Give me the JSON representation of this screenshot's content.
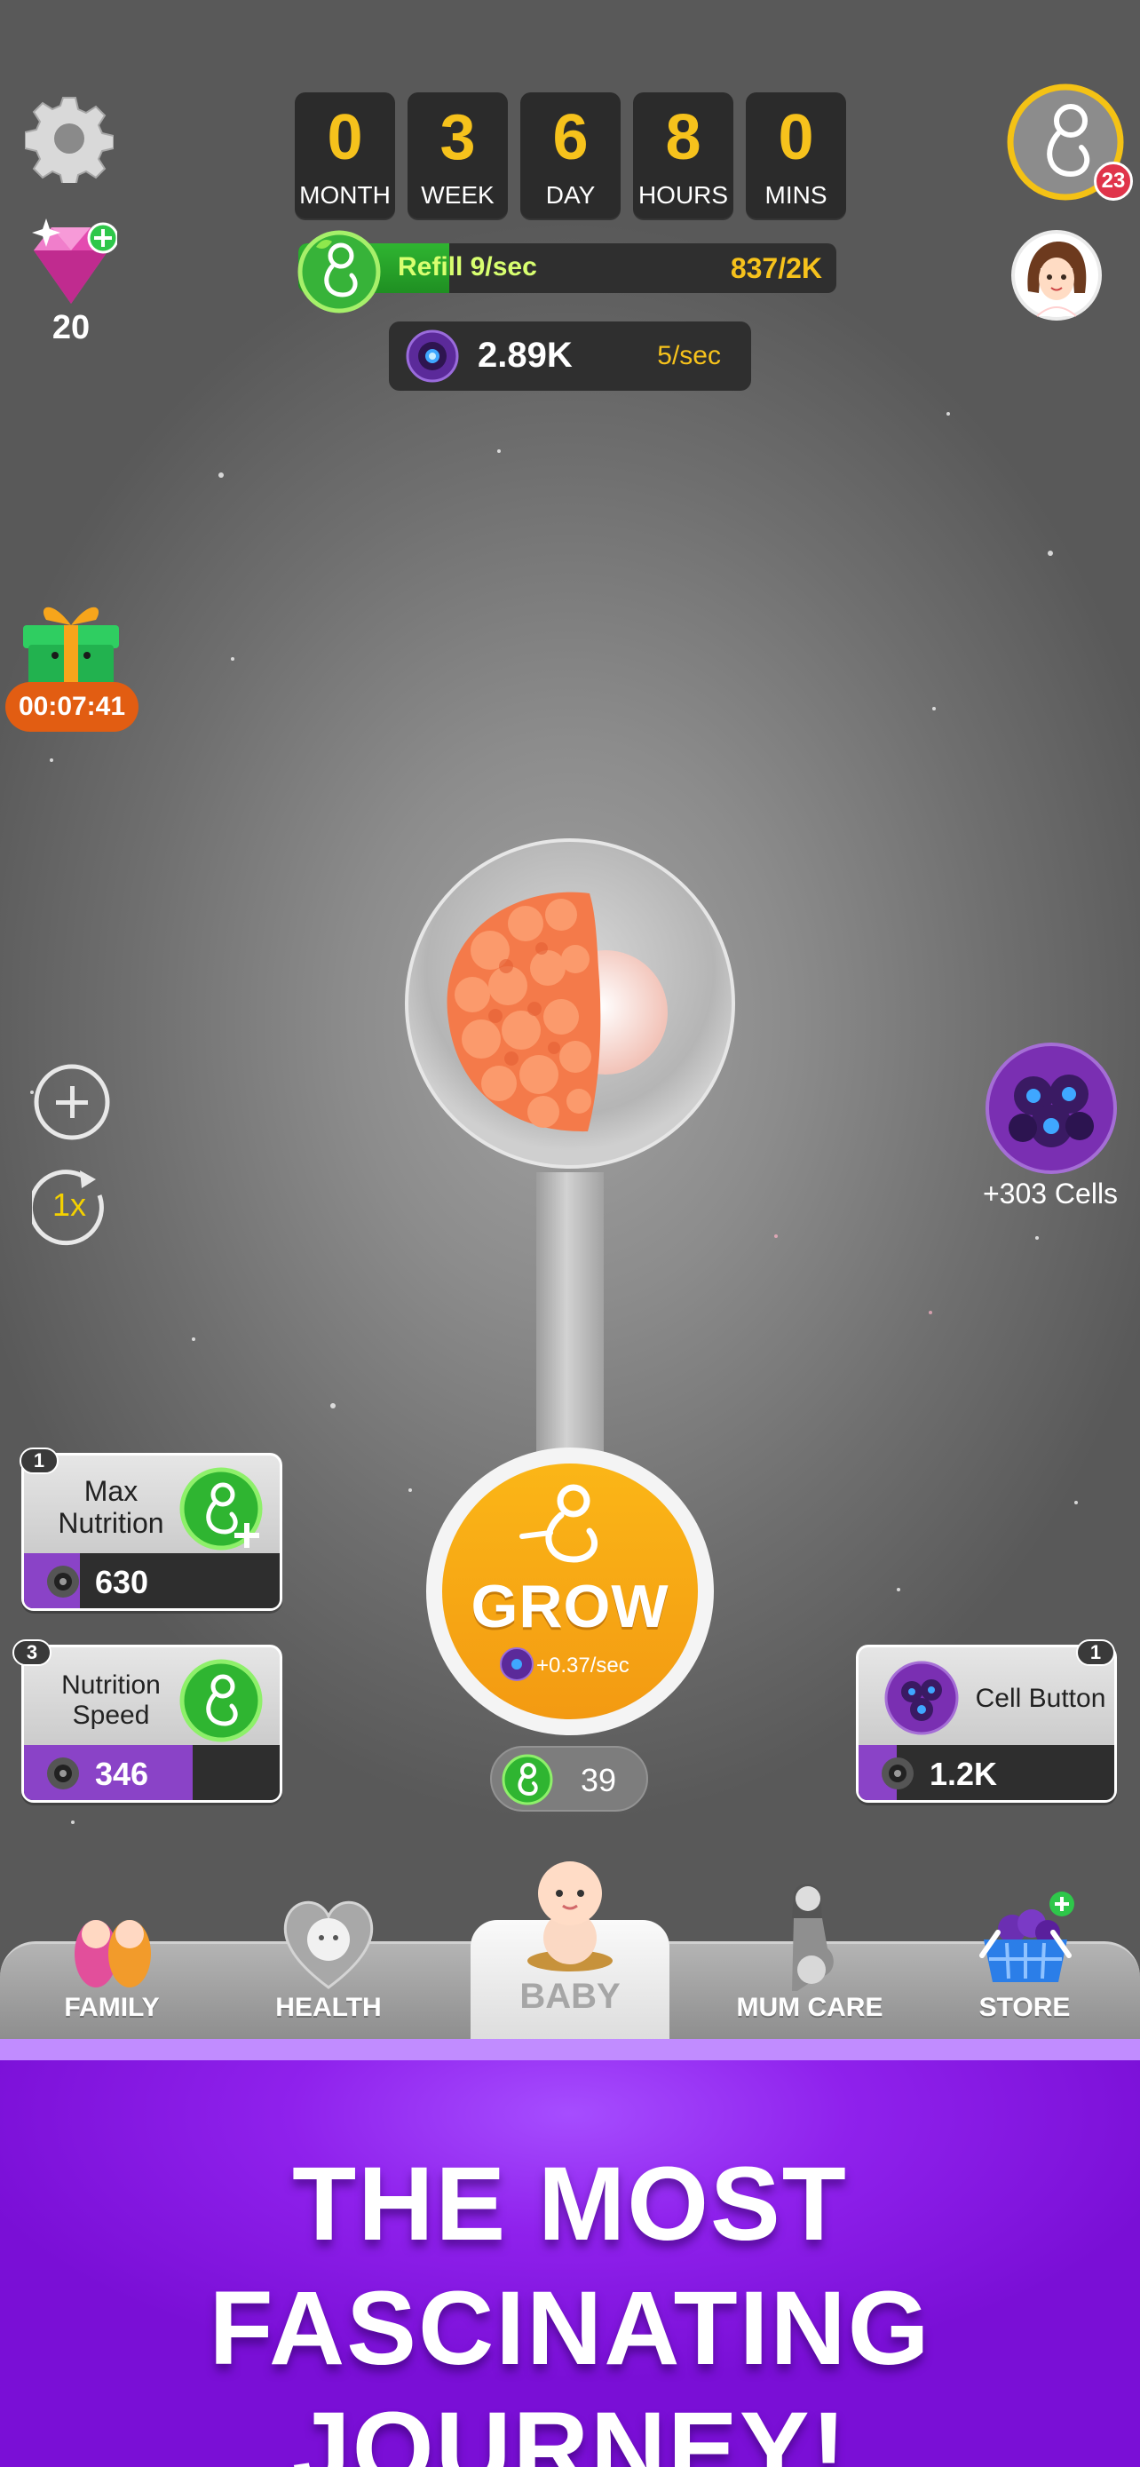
{
  "gems": {
    "count": "20"
  },
  "timer": [
    {
      "value": "0",
      "label": "MONTH"
    },
    {
      "value": "3",
      "label": "WEEK"
    },
    {
      "value": "6",
      "label": "DAY"
    },
    {
      "value": "8",
      "label": "HOURS"
    },
    {
      "value": "0",
      "label": "MINS"
    }
  ],
  "refill": {
    "text": "Refill 9/sec",
    "count": "837/2K",
    "progress": 0.28
  },
  "cells": {
    "value": "2.89K",
    "rate": "5/sec"
  },
  "notifications": {
    "badge": "23"
  },
  "gift": {
    "timer": "00:07:41"
  },
  "controls": {
    "speed": "1x"
  },
  "cell_bonus": {
    "label": "+303 Cells"
  },
  "upgrades": {
    "max_nutrition": {
      "level": "1",
      "title_line1": "Max",
      "title_line2": "Nutrition",
      "cost": "630",
      "progress": 0.22
    },
    "nutrition_speed": {
      "level": "3",
      "title_line1": "Nutrition",
      "title_line2": "Speed",
      "cost": "346",
      "progress": 0.66
    },
    "cell_button": {
      "level": "1",
      "title": "Cell Button",
      "cost": "1.2K",
      "progress": 0.15
    }
  },
  "grow": {
    "label": "GROW",
    "rate": "+0.37/sec"
  },
  "counter": {
    "value": "39"
  },
  "nav": {
    "family": "FAMILY",
    "health": "HEALTH",
    "baby": "BABY",
    "mum_care": "MUM CARE",
    "store": "STORE"
  },
  "promo": {
    "line1": "THE MOST",
    "line2": "FASCINATING JOURNEY!"
  },
  "colors": {
    "accent_yellow": "#f6c21c",
    "grow_orange": "#f7a415",
    "green": "#2fb531",
    "purple": "#8f21ec"
  }
}
